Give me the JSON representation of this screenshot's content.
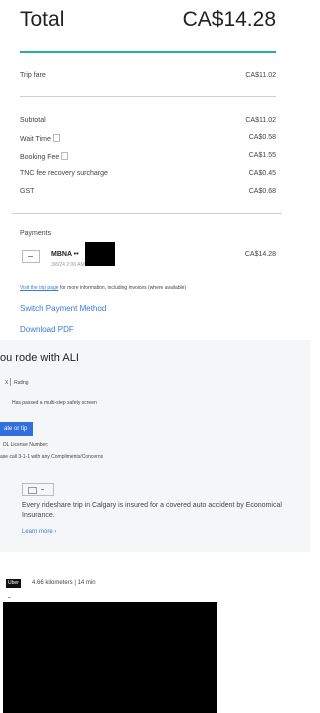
{
  "summary": {
    "total_label": "Total",
    "total_value": "CA$14.28"
  },
  "fare": {
    "label": "Trip fare",
    "value": "CA$11.02"
  },
  "breakdown": [
    {
      "label": "Subtotal",
      "value": "CA$11.02",
      "has_icon": false
    },
    {
      "label": "Wait Time",
      "value": "CA$0.58",
      "has_icon": true
    },
    {
      "label": "Booking Fee",
      "value": "CA$1.55",
      "has_icon": true
    },
    {
      "label": "TNC fee recovery surcharge",
      "value": "CA$0.45",
      "has_icon": false
    },
    {
      "label": "GST",
      "value": "CA$0.68",
      "has_icon": false
    }
  ],
  "payments": {
    "heading": "Payments",
    "card_name": "MBNA ••",
    "card_date": "3/8/24 2:06 AM",
    "amount": "CA$14.28",
    "trip_page_link": "Visit the trip page",
    "trip_page_text": " for more information, including invoices (where available)",
    "switch_payment": "Switch Payment Method",
    "download_pdf": "Download PDF"
  },
  "driver": {
    "title": "ou rode with ALI",
    "rating_prefix": "X",
    "rating_label": "Rating",
    "safety_text": "Has passed a multi-step safety screen",
    "rate_button": "ate or tip",
    "license_label": "DL License Number:",
    "contact_text": "ase call 3-1-1 with any Compliments/Concerns"
  },
  "insurance": {
    "text": "Every rideshare trip in Calgary is insured for a covered auto accident by Economical Insurance.",
    "learn_more": "Learn more ›"
  },
  "trip": {
    "service_badge": "Uber",
    "distance_time": "4.66 kilometers | 14 min"
  }
}
